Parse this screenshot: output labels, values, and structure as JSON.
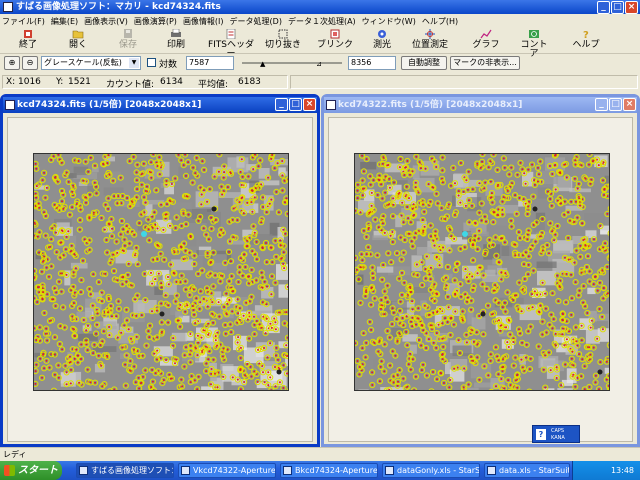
{
  "title": "すばる画像処理ソフト：マカリ - kcd74324.fits",
  "menu": [
    "ファイル(F)",
    "編集(E)",
    "画像表示(V)",
    "画像演算(P)",
    "画像情報(I)",
    "データ処理(D)",
    "データ１次処理(A)",
    "ウィンドウ(W)",
    "ヘルプ(H)"
  ],
  "toolbar": {
    "exit": "終了",
    "open": "開く",
    "save": "保存",
    "print": "印刷",
    "fits_header": "FITSヘッダー",
    "crop": "切り抜き",
    "blink": "ブリンク",
    "photometry": "測光",
    "astrometry": "位置測定",
    "graph": "グラフ",
    "contour": "コントア",
    "help": "ヘルプ"
  },
  "controls": {
    "display_mode": "グレースケール(反転)",
    "log_label": "対数",
    "min_value": "7587",
    "max_value": "8356",
    "auto_adjust": "自動調整",
    "hide_marks": "マークの非表示..."
  },
  "coords": {
    "x_label": "X:",
    "x": "1016",
    "y_label": "Y:",
    "y": "1521",
    "count_label": "カウント値:",
    "count": "6134",
    "mean_label": "平均値:",
    "mean": "6183"
  },
  "windows": [
    {
      "title": "kcd74324.fits (1/5倍) [2048x2048x1]"
    },
    {
      "title": "kcd74322.fits (1/5倍) [2048x2048x1]"
    }
  ],
  "langbar": {
    "ime": "CAPS",
    "kana": "KANA"
  },
  "status": "レディ",
  "taskbar": {
    "start": "スタート",
    "tasks": [
      "すばる画像処理ソフト：マ...",
      "Vkcd74322-Aperture...",
      "Bkcd74324-Aperture...",
      "dataGonly.xls - StarS...",
      "data.xls - StarSuite 7"
    ],
    "clock": "13:48"
  },
  "colors": {
    "accent": "#0a46c9",
    "star_ring": "#e0e000",
    "star_core": "#e02020"
  }
}
